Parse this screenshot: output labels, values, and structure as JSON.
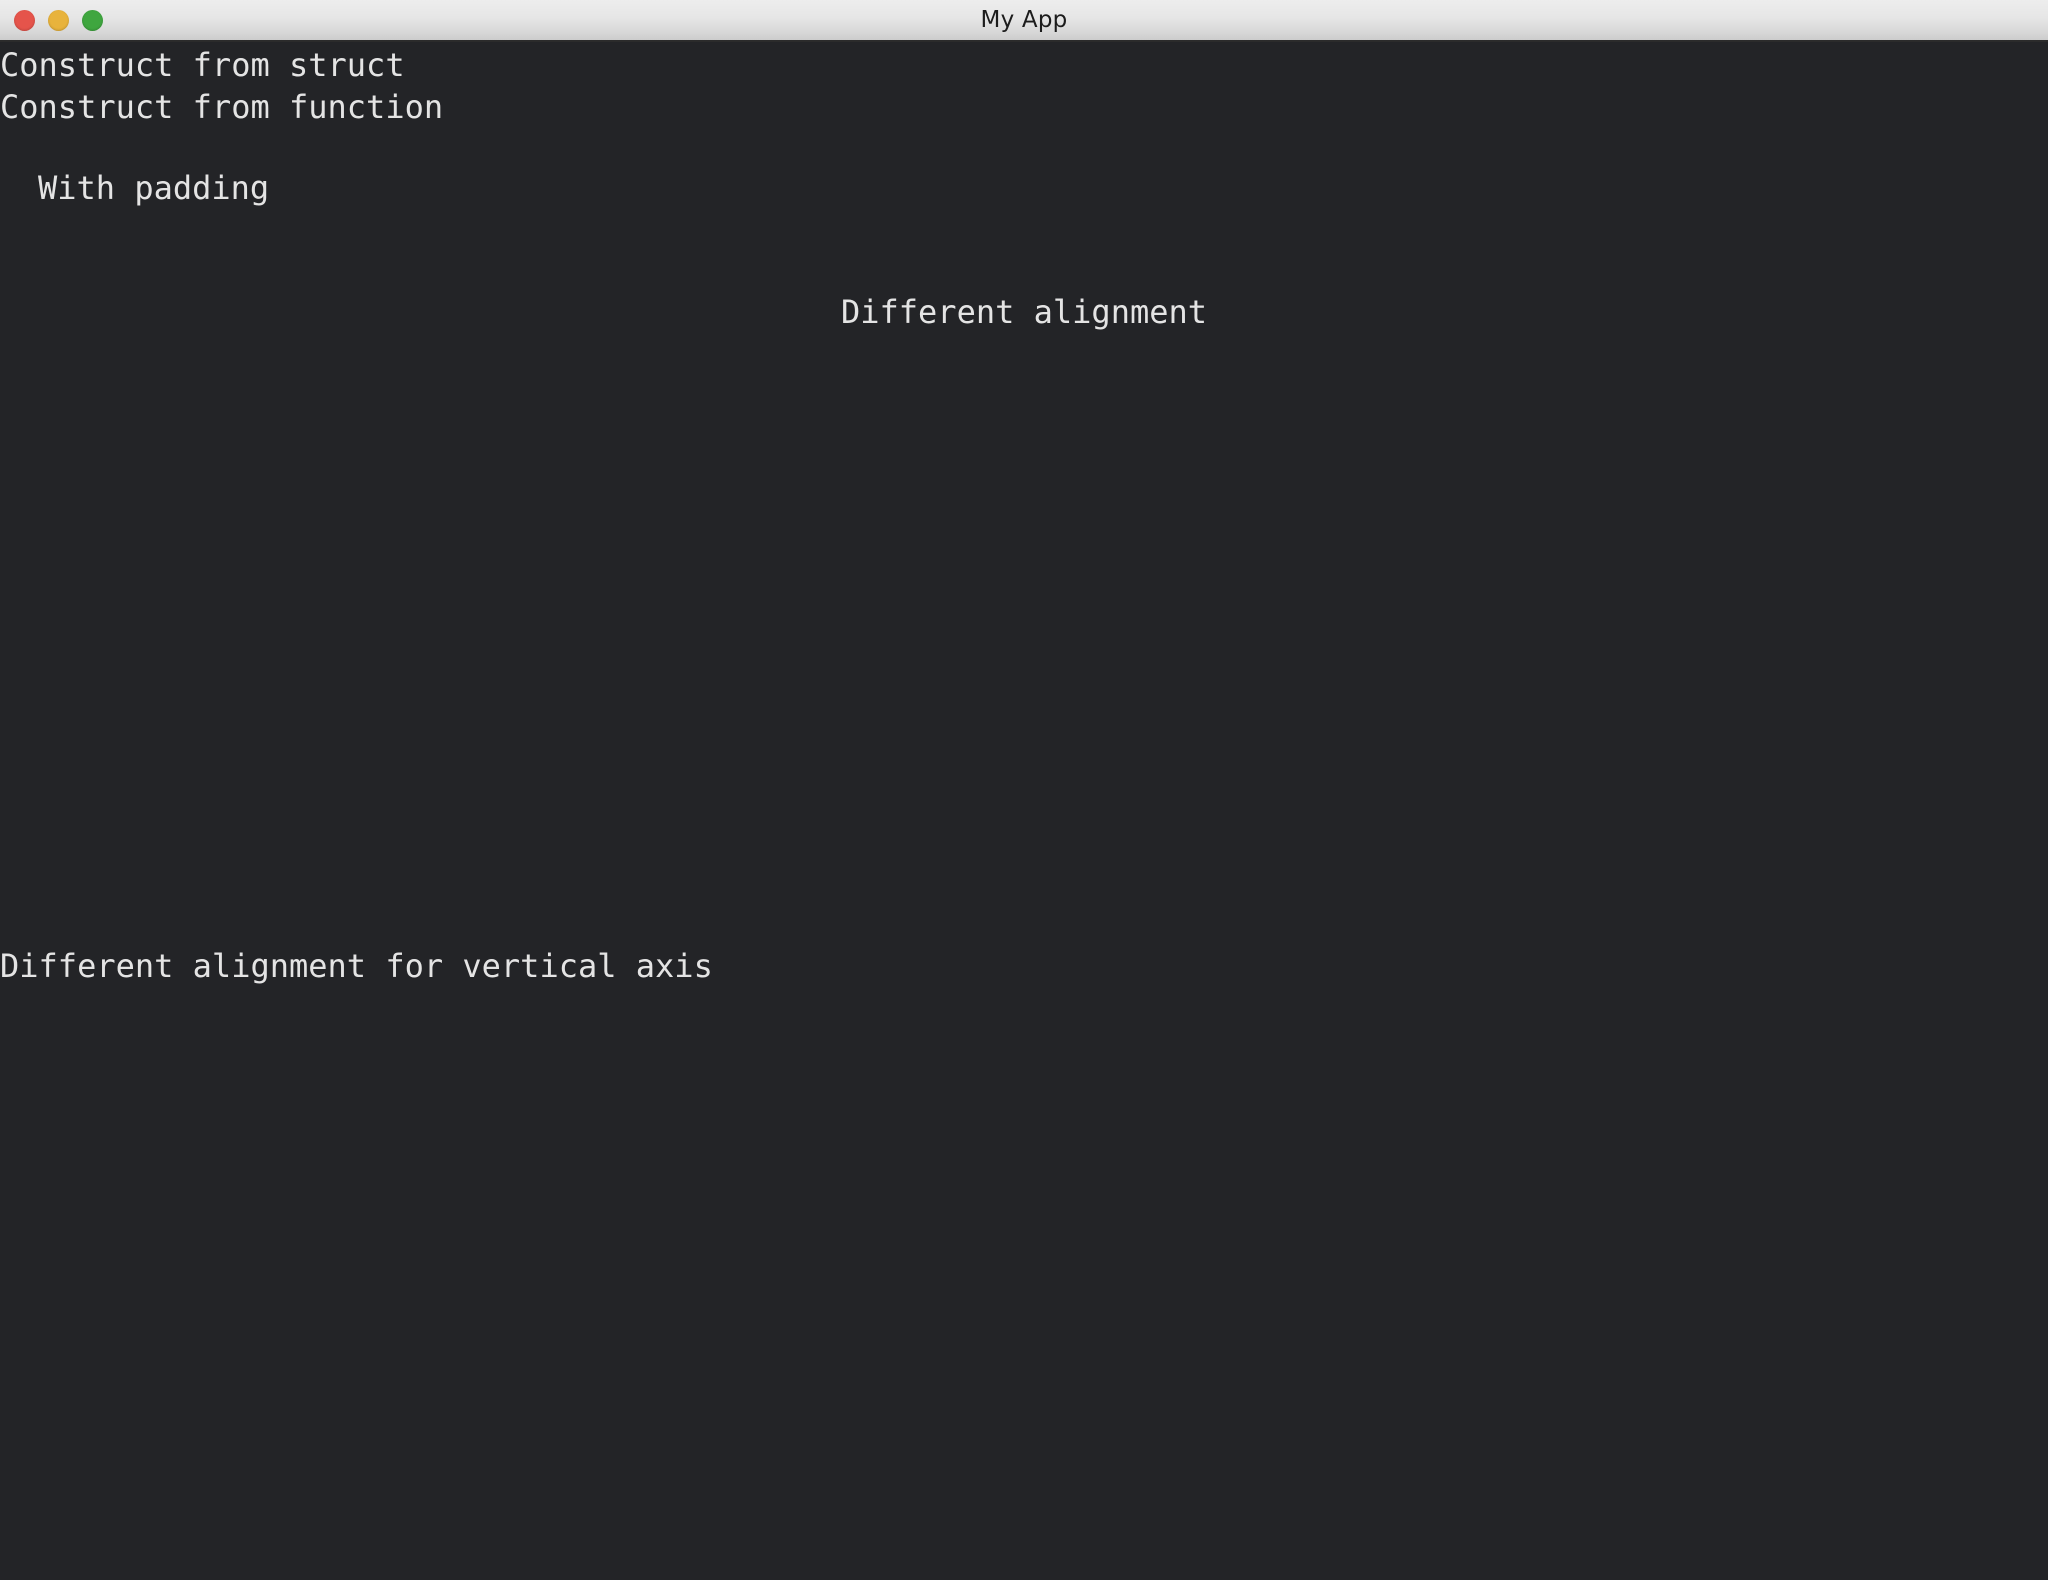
{
  "window": {
    "title": "My App",
    "background_color": "#232427",
    "text_color": "#e4e4e4",
    "titlebar": {
      "background_top_color": "#ededed",
      "background_bottom_color": "#cccccc",
      "title_color": "#1c1c1c",
      "controls": [
        {
          "name": "close",
          "label": "Close",
          "color": "#e5544b"
        },
        {
          "name": "minimize",
          "label": "Minimize",
          "color": "#e8b33c"
        },
        {
          "name": "zoom",
          "label": "Zoom",
          "color": "#3fa63f"
        }
      ]
    }
  },
  "content": {
    "lines": [
      {
        "text": "Construct from struct",
        "align": "left"
      },
      {
        "text": "Construct from function",
        "align": "left"
      },
      {
        "text": "With padding",
        "align": "left-padded"
      },
      {
        "text": "Different alignment",
        "align": "center"
      },
      {
        "text": "Different alignment for vertical axis",
        "align": "left"
      }
    ]
  }
}
